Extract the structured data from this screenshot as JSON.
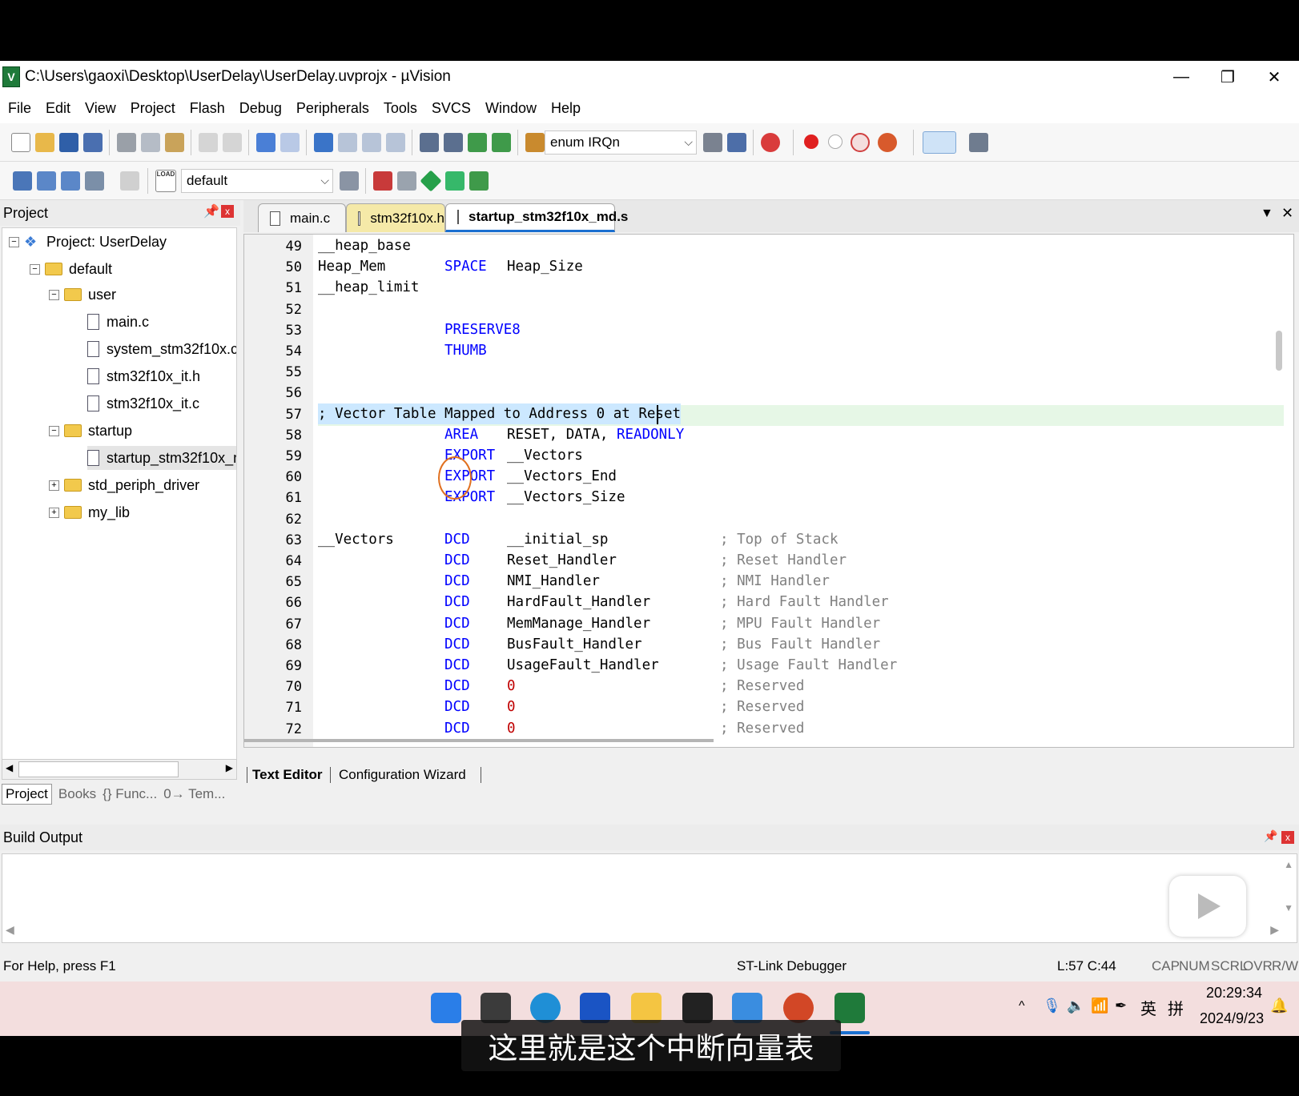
{
  "window": {
    "title": "C:\\Users\\gaoxi\\Desktop\\UserDelay\\UserDelay.uvprojx - µVision",
    "app_icon": "V"
  },
  "menu": [
    "File",
    "Edit",
    "View",
    "Project",
    "Flash",
    "Debug",
    "Peripherals",
    "Tools",
    "SVCS",
    "Window",
    "Help"
  ],
  "toolbar": {
    "find_combo": "enum IRQn",
    "target_combo": "default",
    "load_label": "LOAD"
  },
  "project": {
    "title": "Project",
    "tree": [
      {
        "label": "Project: UserDelay"
      },
      {
        "label": "default"
      },
      {
        "label": "user"
      },
      {
        "label": "main.c"
      },
      {
        "label": "system_stm32f10x.c"
      },
      {
        "label": "stm32f10x_it.h"
      },
      {
        "label": "stm32f10x_it.c"
      },
      {
        "label": "startup"
      },
      {
        "label": "startup_stm32f10x_md.s"
      },
      {
        "label": "std_periph_driver"
      },
      {
        "label": "my_lib"
      }
    ],
    "tabs": [
      "Project",
      "Books",
      "{} Func...",
      "0→ Tem..."
    ]
  },
  "editor": {
    "tabs": [
      "main.c",
      "stm32f10x.h",
      "startup_stm32f10x_md.s"
    ],
    "bottom_tabs": [
      "Text Editor",
      "Configuration Wizard"
    ],
    "lines": [
      {
        "n": "49",
        "label": "__heap_base",
        "op": "",
        "arg": "",
        "cmt": ""
      },
      {
        "n": "50",
        "label": "Heap_Mem",
        "op": "SPACE",
        "arg": "Heap_Size",
        "cmt": ""
      },
      {
        "n": "51",
        "label": "__heap_limit",
        "op": "",
        "arg": "",
        "cmt": ""
      },
      {
        "n": "52",
        "label": "",
        "op": "",
        "arg": "",
        "cmt": ""
      },
      {
        "n": "53",
        "label": "",
        "op": "PRESERVE8",
        "arg": "",
        "cmt": ""
      },
      {
        "n": "54",
        "label": "",
        "op": "THUMB",
        "arg": "",
        "cmt": ""
      },
      {
        "n": "55",
        "label": "",
        "op": "",
        "arg": "",
        "cmt": ""
      },
      {
        "n": "56",
        "label": "",
        "op": "",
        "arg": "",
        "cmt": ""
      },
      {
        "n": "57",
        "label": "; Vector Table Mapped to Address 0 at Reset",
        "op": "",
        "arg": "",
        "cmt": ""
      },
      {
        "n": "58",
        "label": "",
        "op": "AREA",
        "arg": "RESET, DATA, ",
        "arg2": "READONLY",
        "cmt": ""
      },
      {
        "n": "59",
        "label": "",
        "op": "EXPORT",
        "arg": "__Vectors",
        "cmt": ""
      },
      {
        "n": "60",
        "label": "",
        "op": "EXPORT",
        "arg": "__Vectors_End",
        "cmt": ""
      },
      {
        "n": "61",
        "label": "",
        "op": "EXPORT",
        "arg": "__Vectors_Size",
        "cmt": ""
      },
      {
        "n": "62",
        "label": "",
        "op": "",
        "arg": "",
        "cmt": ""
      },
      {
        "n": "63",
        "label": "__Vectors",
        "op": "DCD",
        "arg": "__initial_sp",
        "cmt": "; Top of Stack"
      },
      {
        "n": "64",
        "label": "",
        "op": "DCD",
        "arg": "Reset_Handler",
        "cmt": "; Reset Handler"
      },
      {
        "n": "65",
        "label": "",
        "op": "DCD",
        "arg": "NMI_Handler",
        "cmt": "; NMI Handler"
      },
      {
        "n": "66",
        "label": "",
        "op": "DCD",
        "arg": "HardFault_Handler",
        "cmt": "; Hard Fault Handler"
      },
      {
        "n": "67",
        "label": "",
        "op": "DCD",
        "arg": "MemManage_Handler",
        "cmt": "; MPU Fault Handler"
      },
      {
        "n": "68",
        "label": "",
        "op": "DCD",
        "arg": "BusFault_Handler",
        "cmt": "; Bus Fault Handler"
      },
      {
        "n": "69",
        "label": "",
        "op": "DCD",
        "arg": "UsageFault_Handler",
        "cmt": "; Usage Fault Handler"
      },
      {
        "n": "70",
        "label": "",
        "op": "DCD",
        "num": "0",
        "cmt": "; Reserved"
      },
      {
        "n": "71",
        "label": "",
        "op": "DCD",
        "num": "0",
        "cmt": "; Reserved"
      },
      {
        "n": "72",
        "label": "",
        "op": "DCD",
        "num": "0",
        "cmt": "; Reserved"
      }
    ]
  },
  "build": {
    "title": "Build Output"
  },
  "status": {
    "help": "For Help, press F1",
    "debugger": "ST-Link Debugger",
    "position": "L:57 C:44",
    "cap": "CAP",
    "num": "NUM",
    "scrl": "SCRL",
    "ovr": "OVR",
    "rw": "R/W"
  },
  "taskbar": {
    "time": "20:29:34",
    "date": "2024/9/23",
    "ime": "英",
    "ime2": "拼"
  },
  "subtitle": "这里就是这个中断向量表",
  "colors": {
    "keyword": "#0000ff",
    "number": "#c00000",
    "comment": "#808080",
    "highlight": "#e6f7e6",
    "selection": "#cce8ff"
  }
}
